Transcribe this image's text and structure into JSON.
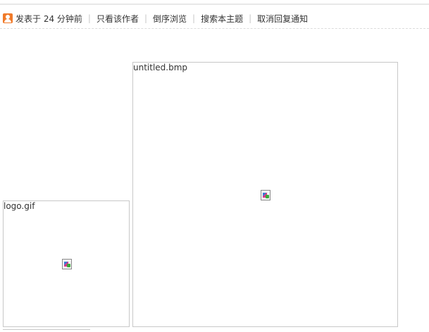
{
  "post_toolbar": {
    "posted_time": "发表于 24 分钟前",
    "only_author": "只看该作者",
    "reverse_order": "倒序浏览",
    "search_topic": "搜索本主题",
    "cancel_notify": "取消回复通知",
    "separator": "|"
  },
  "attachments": [
    {
      "filename": "untitled.bmp"
    },
    {
      "filename": "logo.gif"
    }
  ],
  "colors": {
    "user_icon": "#f07a2a",
    "border": "#c8c8c8",
    "text": "#333333"
  }
}
